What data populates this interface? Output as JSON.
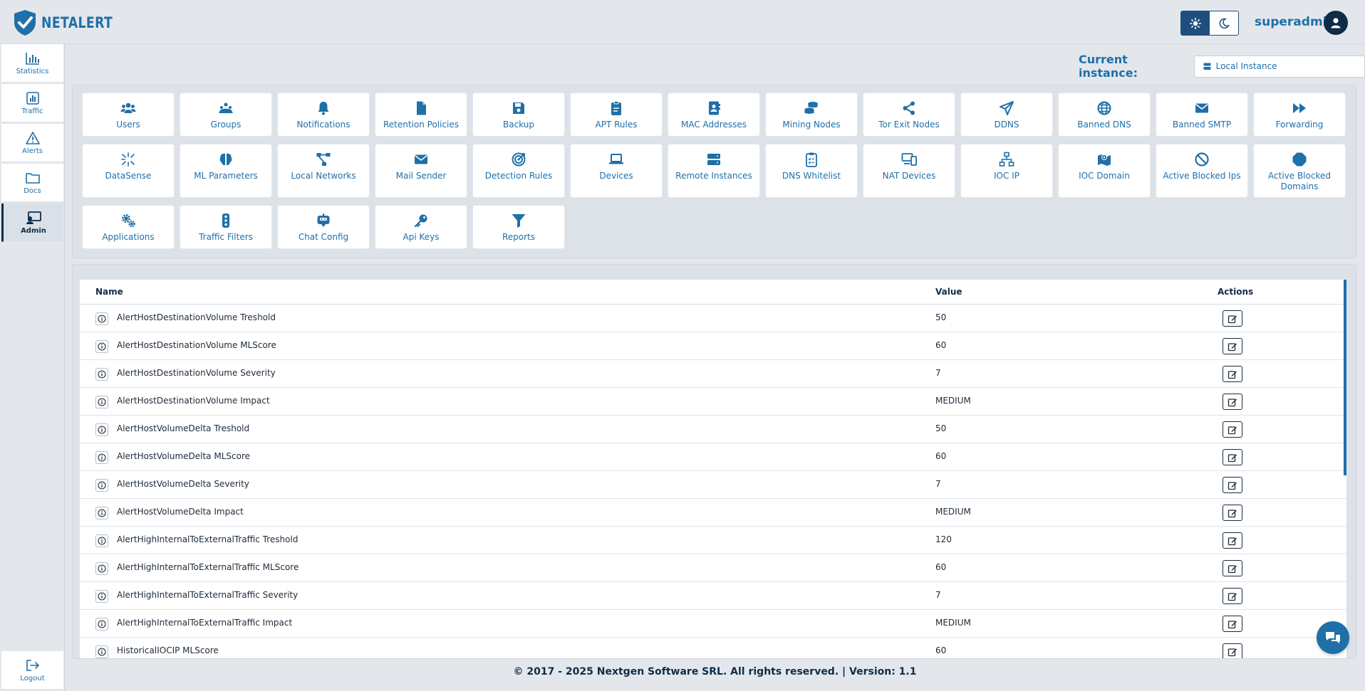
{
  "app": {
    "logo_text": "NETALERT"
  },
  "header": {
    "username": "superadmin",
    "theme_light_icon": "sun-icon",
    "theme_dark_icon": "moon-icon"
  },
  "sidebar": {
    "items": [
      {
        "label": "Statistics",
        "icon": "bar-chart-icon"
      },
      {
        "label": "Traffic",
        "icon": "chart-icon"
      },
      {
        "label": "Alerts",
        "icon": "warning-icon"
      },
      {
        "label": "Docs",
        "icon": "folder-icon"
      },
      {
        "label": "Admin",
        "icon": "admin-icon"
      }
    ],
    "logout_label": "Logout"
  },
  "instance": {
    "label": "Current instance:",
    "value": "Local Instance"
  },
  "tiles": [
    {
      "label": "Users",
      "icon": "users-icon"
    },
    {
      "label": "Groups",
      "icon": "groups-icon"
    },
    {
      "label": "Notifications",
      "icon": "bell-icon"
    },
    {
      "label": "Retention Policies",
      "icon": "file-icon"
    },
    {
      "label": "Backup",
      "icon": "save-icon"
    },
    {
      "label": "APT Rules",
      "icon": "clipboard-icon"
    },
    {
      "label": "MAC Addresses",
      "icon": "address-book-icon"
    },
    {
      "label": "Mining Nodes",
      "icon": "coins-icon"
    },
    {
      "label": "Tor Exit Nodes",
      "icon": "share-icon"
    },
    {
      "label": "DDNS",
      "icon": "send-icon"
    },
    {
      "label": "Banned DNS",
      "icon": "globe-icon"
    },
    {
      "label": "Banned SMTP",
      "icon": "envelope-icon"
    },
    {
      "label": "Forwarding",
      "icon": "fast-forward-icon"
    },
    {
      "label": "DataSense",
      "icon": "sparkle-icon"
    },
    {
      "label": "ML Parameters",
      "icon": "brain-icon"
    },
    {
      "label": "Local Networks",
      "icon": "network-icon"
    },
    {
      "label": "Mail Sender",
      "icon": "envelope-icon"
    },
    {
      "label": "Detection Rules",
      "icon": "target-icon"
    },
    {
      "label": "Devices",
      "icon": "laptop-icon"
    },
    {
      "label": "Remote Instances",
      "icon": "server-icon"
    },
    {
      "label": "DNS Whitelist",
      "icon": "clipboard-list-icon"
    },
    {
      "label": "NAT Devices",
      "icon": "devices-icon"
    },
    {
      "label": "IOC IP",
      "icon": "sitemap-icon"
    },
    {
      "label": "IOC Domain",
      "icon": "map-icon"
    },
    {
      "label": "Active Blocked Ips",
      "icon": "ban-icon"
    },
    {
      "label": "Active Blocked Domains",
      "icon": "octagon-icon"
    },
    {
      "label": "Applications",
      "icon": "cogs-icon"
    },
    {
      "label": "Traffic Filters",
      "icon": "traffic-light-icon"
    },
    {
      "label": "Chat Config",
      "icon": "robot-icon"
    },
    {
      "label": "Api Keys",
      "icon": "key-icon"
    },
    {
      "label": "Reports",
      "icon": "filter-icon"
    }
  ],
  "table": {
    "headers": {
      "name": "Name",
      "value": "Value",
      "actions": "Actions"
    },
    "rows": [
      {
        "name": "AlertHostDestinationVolume Treshold",
        "value": "50"
      },
      {
        "name": "AlertHostDestinationVolume MLScore",
        "value": "60"
      },
      {
        "name": "AlertHostDestinationVolume Severity",
        "value": "7"
      },
      {
        "name": "AlertHostDestinationVolume Impact",
        "value": "MEDIUM"
      },
      {
        "name": "AlertHostVolumeDelta Treshold",
        "value": "50"
      },
      {
        "name": "AlertHostVolumeDelta MLScore",
        "value": "60"
      },
      {
        "name": "AlertHostVolumeDelta Severity",
        "value": "7"
      },
      {
        "name": "AlertHostVolumeDelta Impact",
        "value": "MEDIUM"
      },
      {
        "name": "AlertHighInternalToExternalTraffic Treshold",
        "value": "120"
      },
      {
        "name": "AlertHighInternalToExternalTraffic MLScore",
        "value": "60"
      },
      {
        "name": "AlertHighInternalToExternalTraffic Severity",
        "value": "7"
      },
      {
        "name": "AlertHighInternalToExternalTraffic Impact",
        "value": "MEDIUM"
      },
      {
        "name": "HistoricalIOCIP MLScore",
        "value": "60"
      }
    ]
  },
  "footer": {
    "text": "© 2017 - 2025 Nextgen Software SRL. All rights reserved. | Version: 1.1"
  },
  "colors": {
    "accent": "#1f6fa8",
    "dark": "#0f2c47",
    "background": "#e3e7ec"
  }
}
